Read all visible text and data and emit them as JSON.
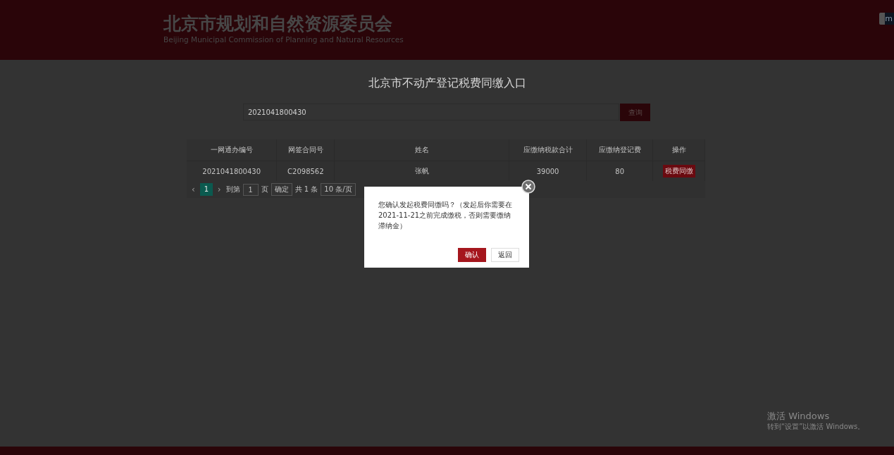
{
  "header": {
    "title": "北京市规划和自然资源委员会",
    "subtitle": "Beijing Municipal Commission of Planning and Natural Resources",
    "corner_badge": "m"
  },
  "page_title": "北京市不动产登记税费同缴入口",
  "search": {
    "value": "2021041800430",
    "button": "查询"
  },
  "table": {
    "columns": [
      "一网通办编号",
      "网签合同号",
      "姓名",
      "应缴纳税款合计",
      "应缴纳登记费",
      "操作"
    ],
    "rows": [
      {
        "cells": [
          "2021041800430",
          "C2098562",
          "张帆",
          "39000",
          "80"
        ],
        "action": "税费同缴"
      }
    ]
  },
  "pagination": {
    "prev": "‹",
    "pages": [
      {
        "label": "1",
        "selected": true
      }
    ],
    "next": "›",
    "goto_label": "到第",
    "goto_value": "1",
    "page_unit": "页",
    "confirm": "确定",
    "total": "共 1 条",
    "page_size": "10 条/页"
  },
  "dialog": {
    "message": "您确认发起税费同缴吗？（发起后你需要在2021-11-21之前完成缴税，否则需要缴纳滞纳金）",
    "buttons": [
      {
        "label": "确认",
        "kind": "primary"
      },
      {
        "label": "返回",
        "kind": "secondary"
      }
    ]
  },
  "activation_notice": {
    "title": "激活 Windows",
    "text": "转到“设置”以激活 Windows。"
  }
}
